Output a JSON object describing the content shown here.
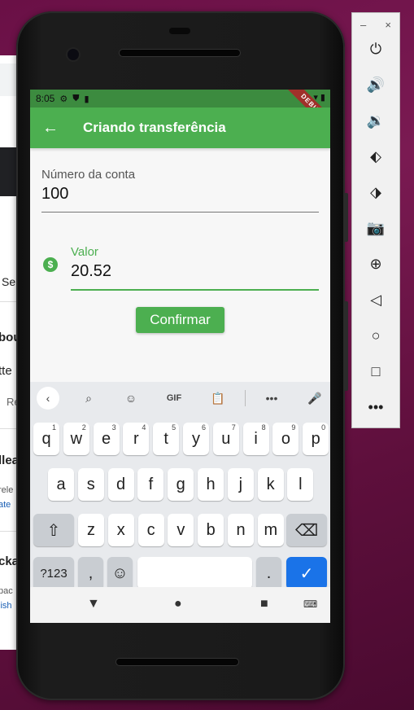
{
  "background_window": {
    "fragments": [
      "Se",
      "bou",
      "tte",
      "Re",
      "llea",
      "rele",
      "ate",
      "cka",
      "pac",
      "lish"
    ]
  },
  "status_bar": {
    "time": "8:05",
    "debug_banner": "DEBUG"
  },
  "app_bar": {
    "back_icon": "arrow-back-icon",
    "title": "Criando transferência"
  },
  "form": {
    "account_field": {
      "label": "Número da conta",
      "value": "100"
    },
    "value_field": {
      "icon": "monetization-icon",
      "label": "Valor",
      "value": "20.52"
    },
    "confirm_label": "Confirmar"
  },
  "keyboard": {
    "toolbar": {
      "gif_label": "GIF",
      "more_label": "•••"
    },
    "row1": [
      {
        "k": "q",
        "s": "1"
      },
      {
        "k": "w",
        "s": "2"
      },
      {
        "k": "e",
        "s": "3"
      },
      {
        "k": "r",
        "s": "4"
      },
      {
        "k": "t",
        "s": "5"
      },
      {
        "k": "y",
        "s": "6"
      },
      {
        "k": "u",
        "s": "7"
      },
      {
        "k": "i",
        "s": "8"
      },
      {
        "k": "o",
        "s": "9"
      },
      {
        "k": "p",
        "s": "0"
      }
    ],
    "row2": [
      "a",
      "s",
      "d",
      "f",
      "g",
      "h",
      "j",
      "k",
      "l"
    ],
    "row3": [
      "z",
      "x",
      "c",
      "v",
      "b",
      "n",
      "m"
    ],
    "symbols_label": "?123",
    "comma_label": ",",
    "period_label": ".",
    "accent_color": "#1a73e8"
  },
  "emulator_toolbar": {
    "minimize": "–",
    "close": "×",
    "more": "•••"
  },
  "colors": {
    "primary": "#4caf50",
    "status_bar": "#3c8b3f"
  }
}
